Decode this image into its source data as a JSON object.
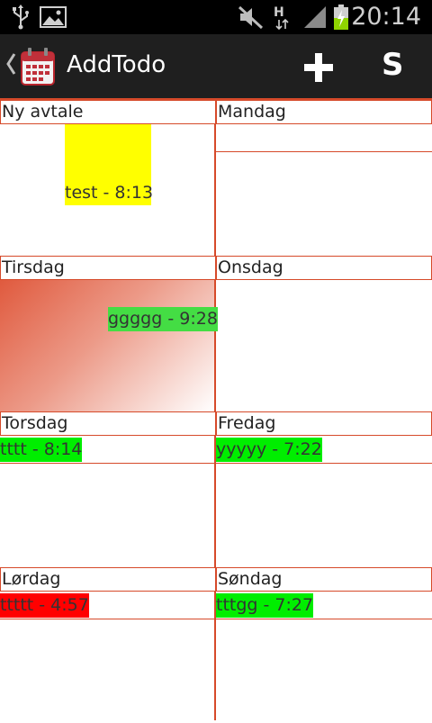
{
  "status_bar": {
    "time": "20:14",
    "icons": [
      "usb-icon",
      "image-icon",
      "mute-icon",
      "hspa-icon",
      "signal-icon",
      "battery-charging-icon"
    ]
  },
  "action_bar": {
    "title": "AddTodo",
    "back_icon": "chevron-left-icon",
    "app_icon": "calendar-icon",
    "add_icon": "plus-icon",
    "s_label": "S"
  },
  "cells": {
    "ny_avtale": {
      "header": "Ny avtale",
      "items": [
        {
          "text": "test - 8:13",
          "color": "#ffff00"
        }
      ]
    },
    "mandag": {
      "header": "Mandag",
      "items": []
    },
    "tirsdag": {
      "header": "Tirsdag",
      "items": [
        {
          "text": "ggggg - 9:28",
          "color": "#44dd44"
        }
      ]
    },
    "onsdag": {
      "header": "Onsdag",
      "items": []
    },
    "torsdag": {
      "header": "Torsdag",
      "items": [
        {
          "text": "tttt - 8:14",
          "color": "#00ee00"
        }
      ]
    },
    "fredag": {
      "header": "Fredag",
      "items": [
        {
          "text": "yyyyy - 7:22",
          "color": "#00ee00"
        }
      ]
    },
    "lordag": {
      "header": "Lørdag",
      "items": [
        {
          "text": "ttttt - 4:57",
          "color": "#ff0000"
        }
      ]
    },
    "sondag": {
      "header": "Søndag",
      "items": [
        {
          "text": "tttgg - 7:27",
          "color": "#00ee00"
        }
      ]
    }
  },
  "colors": {
    "accent": "#d64a2a",
    "statusbar_bg": "#000000",
    "actionbar_bg": "#1f1f1f"
  }
}
